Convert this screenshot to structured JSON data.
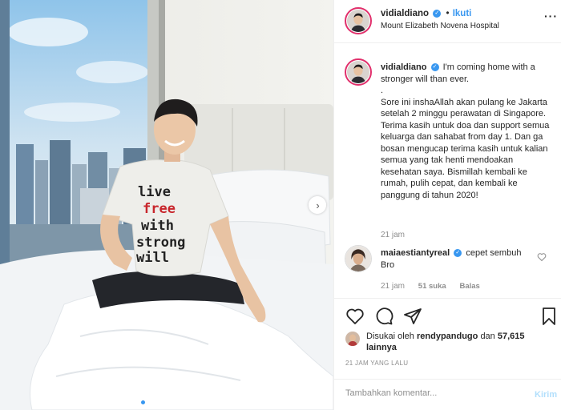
{
  "colors": {
    "accent": "#3897f0",
    "text": "#262626",
    "muted": "#8e8e8e",
    "border": "#efefef"
  },
  "header": {
    "username": "vidialdiano",
    "separator": "•",
    "follow_label": "Ikuti",
    "location": "Mount Elizabeth Novena Hospital",
    "more_icon": "more-horizontal-icon"
  },
  "photo": {
    "shirt_lines": [
      "live",
      "free",
      "with",
      "strong",
      "will"
    ],
    "carousel": {
      "count": 7,
      "active_index": 0
    },
    "next_icon": "chevron-right-icon"
  },
  "caption": {
    "username": "vidialdiano",
    "first_line": "I'm coming home with a stronger will than ever.",
    "dot_line": ".",
    "body": "Sore ini inshaAllah akan pulang ke Jakarta setelah 2 minggu perawatan di Singapore. Terima kasih untuk doa dan support semua keluarga dan sahabat from day 1. Dan ga bosan mengucap terima kasih untuk kalian semua yang tak henti mendoakan kesehatan saya. Bismillah kembali ke rumah, pulih cepat, dan kembali ke panggung di tahun 2020!",
    "time": "21 jam"
  },
  "comment": {
    "username": "maiaestiantyreal",
    "text": "cepet sembuh Bro",
    "time": "21 jam",
    "likes": "51 suka",
    "reply": "Balas"
  },
  "actions": {
    "like_icon": "heart-icon",
    "comment_icon": "comment-icon",
    "share_icon": "share-icon",
    "save_icon": "bookmark-icon"
  },
  "likes": {
    "prefix": "Disukai oleh",
    "user": "rendypandugo",
    "middle": "dan",
    "count": "57,615 lainnya"
  },
  "time_ago": "21 JAM YANG LALU",
  "add_comment": {
    "placeholder": "Tambahkan komentar...",
    "post_label": "Kirim"
  }
}
